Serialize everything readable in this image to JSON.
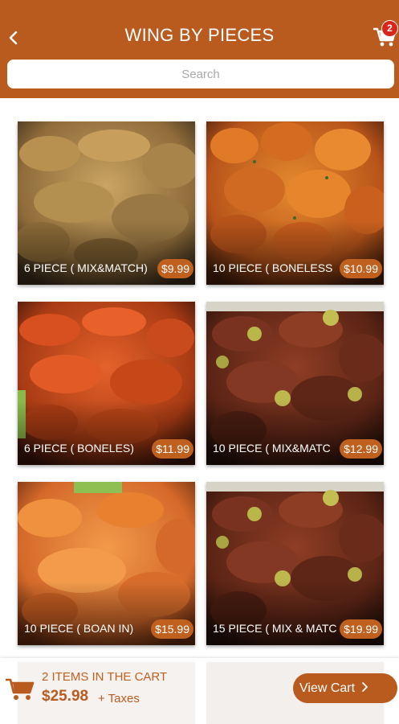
{
  "header": {
    "title": "WING BY PIECES",
    "back_icon": "chevron-left-icon",
    "cart_icon": "shopping-cart-icon",
    "cart_count": "2",
    "brand_color": "#b95a1f"
  },
  "search": {
    "placeholder": "Search"
  },
  "products": [
    {
      "name": "6 PIECE ( MIX&MATCH)",
      "price": "$9.99",
      "image": "plain-wings-photo"
    },
    {
      "name": "10 PIECE ( BONELESS",
      "price": "$10.99",
      "image": "boneless-wings-photo"
    },
    {
      "name": "6 PIECE ( BONELES)",
      "price": "$11.99",
      "image": "buffalo-wings-photo"
    },
    {
      "name": "10 PIECE ( MIX&MATC",
      "price": "$12.99",
      "image": "bbq-wings-photo"
    },
    {
      "name": "10 PIECE ( BOAN IN)",
      "price": "$15.99",
      "image": "buffalo-wings-photo"
    },
    {
      "name": "15 PIECE ( MIX & MATC",
      "price": "$19.99",
      "image": "bbq-wings-photo"
    }
  ],
  "footer": {
    "items_text": "2 ITEMS IN THE CART",
    "total": "$25.98",
    "taxes": "+ Taxes",
    "view_cart": "View Cart",
    "cart_icon": "shopping-cart-icon"
  }
}
